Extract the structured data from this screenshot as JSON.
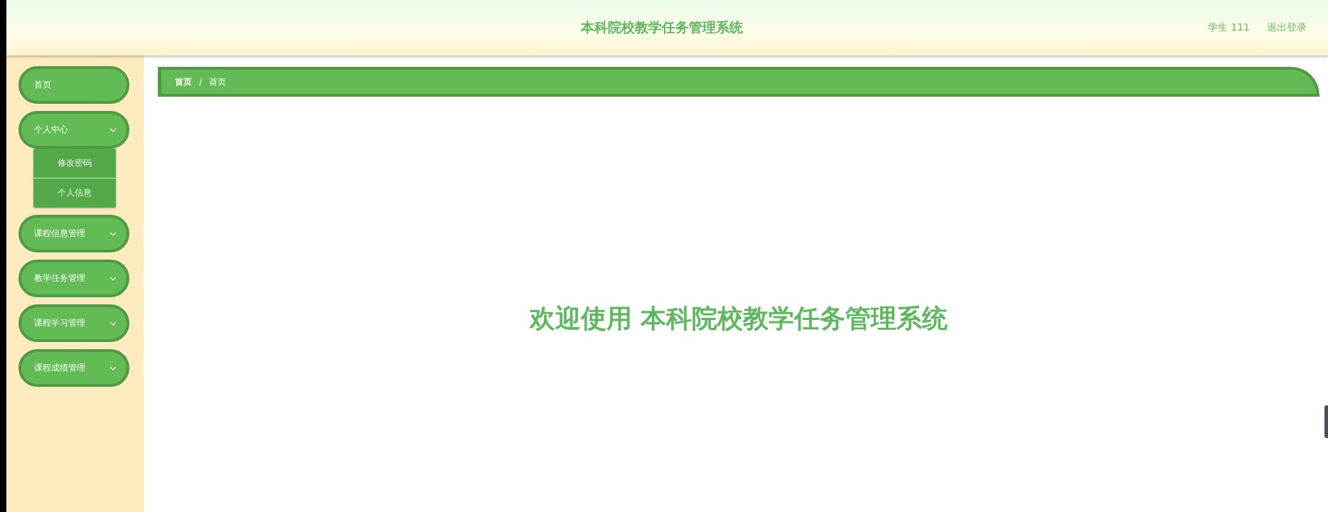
{
  "header": {
    "title": "本科院校教学任务管理系统",
    "user": "学生 111",
    "logout": "退出登录"
  },
  "sidebar": {
    "items": [
      {
        "label": "首页",
        "kind": "link"
      },
      {
        "label": "个人中心",
        "kind": "group",
        "expanded": true,
        "children": [
          {
            "label": "修改密码"
          },
          {
            "label": "个人信息"
          }
        ]
      },
      {
        "label": "课程信息管理",
        "kind": "group",
        "expanded": false
      },
      {
        "label": "教学任务管理",
        "kind": "group",
        "expanded": false
      },
      {
        "label": "课程学习管理",
        "kind": "group",
        "expanded": false
      },
      {
        "label": "课程成绩管理",
        "kind": "group",
        "expanded": false
      }
    ]
  },
  "breadcrumb": {
    "items": [
      "首页",
      "首页"
    ],
    "separator": "/"
  },
  "welcome": "欢迎使用 本科院校教学任务管理系统"
}
